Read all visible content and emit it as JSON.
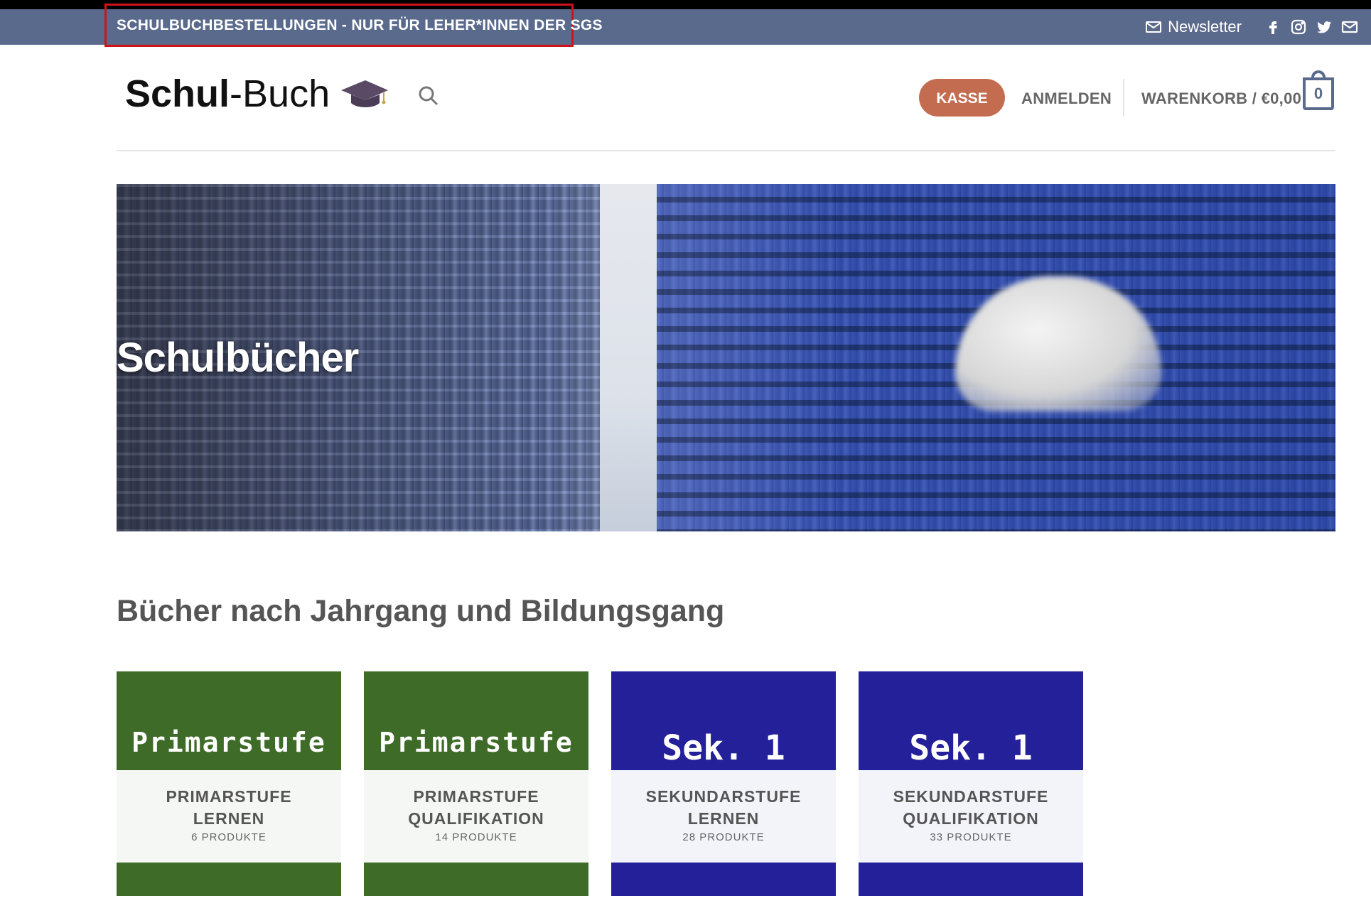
{
  "topbar": {
    "notice": "SCHULBUCHBESTELLUNGEN - NUR FÜR LEHER*INNEN DER SGS",
    "newsletter_label": "Newsletter",
    "social_icons": [
      "facebook-icon",
      "instagram-icon",
      "twitter-icon",
      "mail-icon"
    ]
  },
  "header": {
    "logo_bold": "Schul",
    "logo_rest": "-Buch",
    "kasse_label": "KASSE",
    "anmelden_label": "ANMELDEN",
    "cart_label": "WARENKORB / €0,00",
    "cart_count": "0"
  },
  "hero": {
    "title": "Schulbücher"
  },
  "section": {
    "heading": "Bücher nach Jahrgang und Bildungsgang"
  },
  "cards": [
    {
      "image_text": "Primarstufe",
      "title_line1": "PRIMARSTUFE",
      "title_line2": "LERNEN",
      "count": "6 PRODUKTE",
      "color": "#3e6b27"
    },
    {
      "image_text": "Primarstufe",
      "title_line1": "PRIMARSTUFE",
      "title_line2": "QUALIFIKATION",
      "count": "14 PRODUKTE",
      "color": "#3e6b27"
    },
    {
      "image_text": "Sek. 1",
      "title_line1": "SEKUNDARSTUFE",
      "title_line2": "LERNEN",
      "count": "28 PRODUKTE",
      "color": "#23209a"
    },
    {
      "image_text": "Sek. 1",
      "title_line1": "SEKUNDARSTUFE",
      "title_line2": "QUALIFIKATION",
      "count": "33 PRODUKTE",
      "color": "#23209a"
    }
  ],
  "colors": {
    "topbar": "#5a6a8c",
    "kasse_button": "#c46c4f",
    "notice_border": "#d0131b"
  }
}
